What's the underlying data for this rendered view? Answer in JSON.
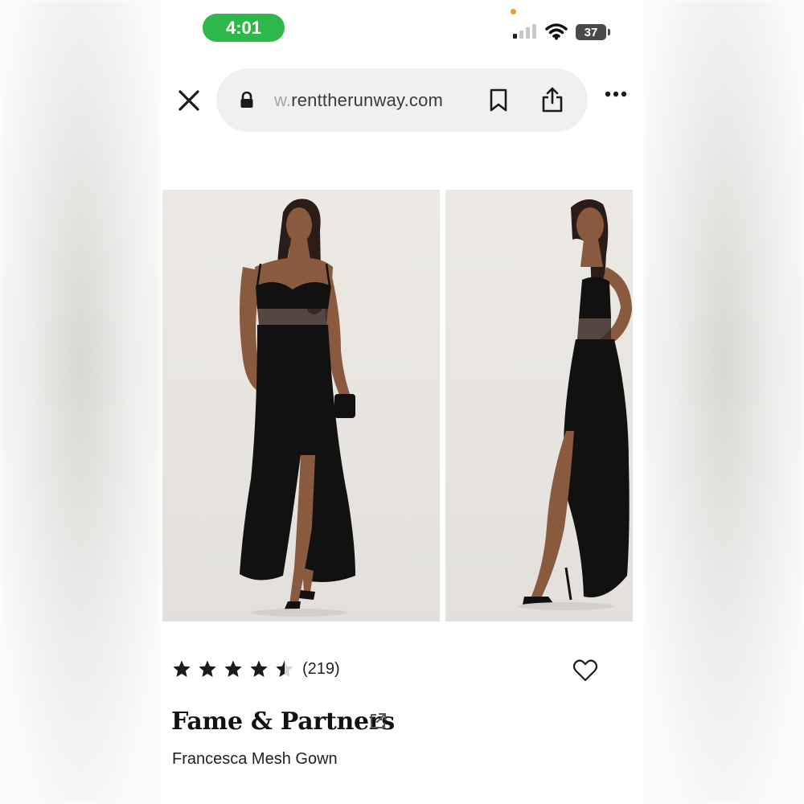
{
  "status_bar": {
    "time": "4:01",
    "battery": "37",
    "signal_bars_active": 1,
    "signal_bars_total": 4
  },
  "browser": {
    "url_faded_prefix": "w.",
    "url_domain": "renttherunway.com",
    "icons": [
      "close-icon",
      "lock-icon",
      "bookmark-icon",
      "share-icon",
      "more-icon"
    ]
  },
  "product": {
    "rating": 4.5,
    "rating_max": 5,
    "review_count": "(219)",
    "brand": "Fame & Partners",
    "name": "Francesca Mesh Gown",
    "images": [
      "front-view",
      "side-view"
    ]
  },
  "colors": {
    "time_pill": "#2fb84a",
    "dress": "#111111",
    "photo_bg": "#ebe8e4",
    "url_bar": "#eff0f2"
  }
}
